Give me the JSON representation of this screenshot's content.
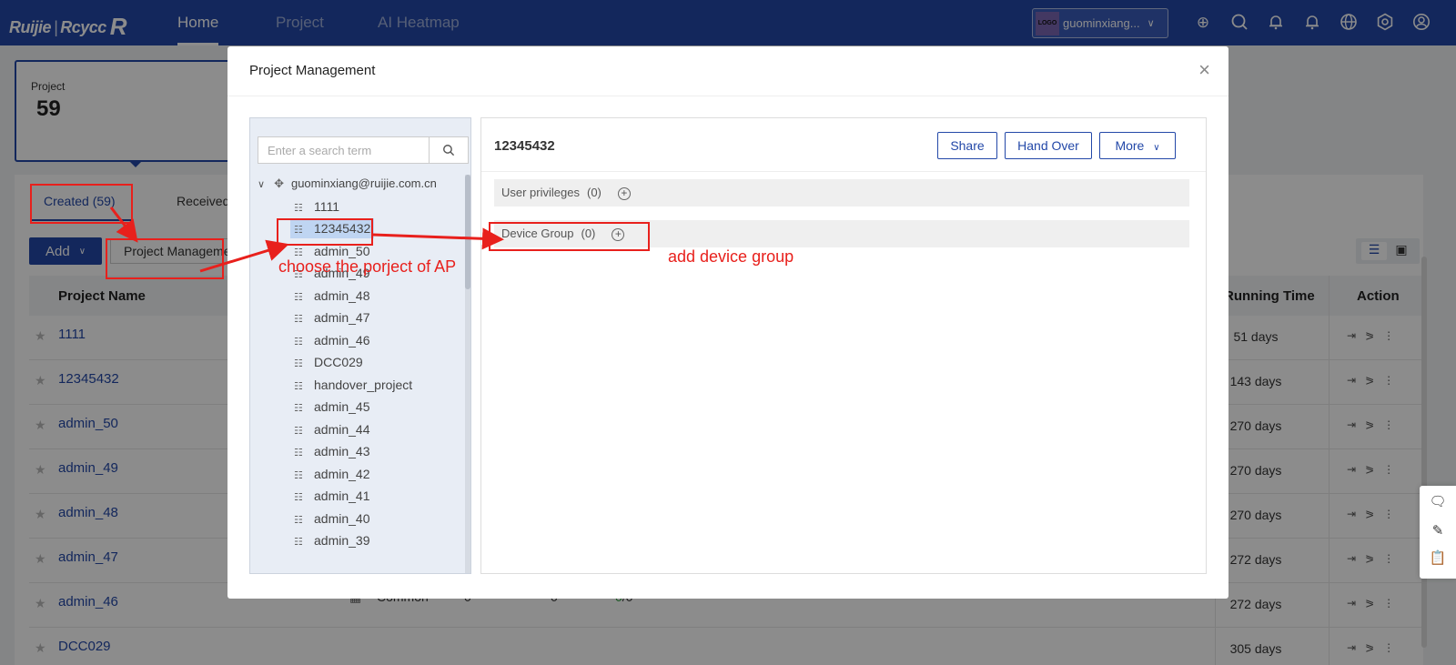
{
  "header": {
    "logo_brand": "Ruijie",
    "logo_sep": "|",
    "logo_product": "Rcycc",
    "logo_mark": "R",
    "nav": [
      {
        "label": "Home",
        "active": true
      },
      {
        "label": "Project",
        "active": false
      },
      {
        "label": "AI Heatmap",
        "active": false
      }
    ],
    "account": {
      "logo_text": "LOGO",
      "name": "guominxiang..."
    },
    "icons": [
      "add-circle-icon",
      "search-icon",
      "bell-icon",
      "alert-bell-icon",
      "globe-icon",
      "gear-icon",
      "user-icon"
    ]
  },
  "background": {
    "project_card": {
      "label": "Project",
      "count": "59"
    },
    "tabs": {
      "created": "Created (59)",
      "received": "Received"
    },
    "add_button": "Add",
    "project_management_button": "Project Management",
    "table": {
      "headers": {
        "name": "Project Name",
        "running_time": "Running Time",
        "action": "Action"
      },
      "rows": [
        {
          "name": "1111",
          "days": "51 days"
        },
        {
          "name": "12345432",
          "days": "143 days"
        },
        {
          "name": "admin_50",
          "days": "270 days"
        },
        {
          "name": "admin_49",
          "days": "270 days"
        },
        {
          "name": "admin_48",
          "days": "270 days"
        },
        {
          "name": "admin_47",
          "days": "272 days"
        },
        {
          "name": "admin_46",
          "days": "272 days"
        },
        {
          "name": "DCC029",
          "days": "305 days"
        }
      ],
      "admin_46_extra": {
        "type": "Common",
        "c1": "0",
        "c2": "0",
        "online": "0",
        "total": "/0",
        "dash": "-"
      }
    }
  },
  "modal": {
    "title": "Project Management",
    "close": "×",
    "search": {
      "placeholder": "Enter a search term"
    },
    "tree": {
      "root": "guominxiang@ruijie.com.cn",
      "items": [
        "1111",
        "12345432",
        "admin_50",
        "admin_49",
        "admin_48",
        "admin_47",
        "admin_46",
        "DCC029",
        "handover_project",
        "admin_45",
        "admin_44",
        "admin_43",
        "admin_42",
        "admin_41",
        "admin_40",
        "admin_39"
      ],
      "selected_index": 1
    },
    "detail": {
      "title": "12345432",
      "buttons": {
        "share": "Share",
        "hand_over": "Hand Over",
        "more": "More"
      },
      "sections": [
        {
          "label": "User privileges",
          "count": "(0)"
        },
        {
          "label": "Device Group",
          "count": "(0)"
        }
      ]
    }
  },
  "annotations": {
    "choose_project": "choose the porject of AP",
    "add_device_group": "add device group",
    "color": "#e8201c"
  }
}
